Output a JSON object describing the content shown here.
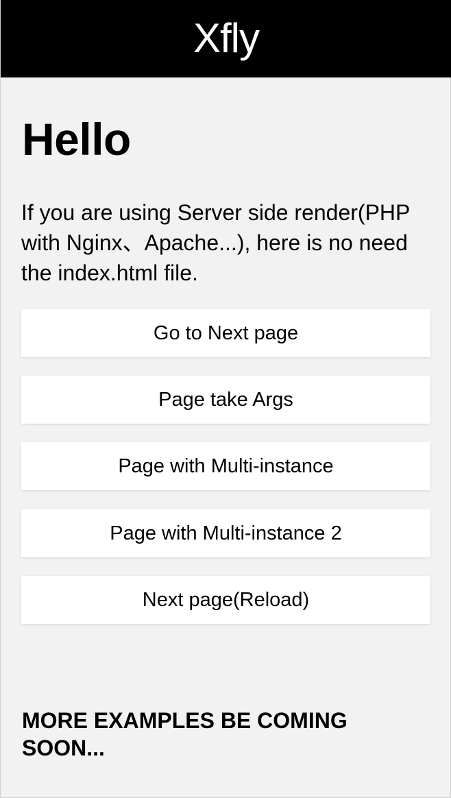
{
  "header": {
    "title": "Xfly"
  },
  "main": {
    "heading": "Hello",
    "intro": "If you are using Server side render(PHP with Nginx、Apache...), here is no need the index.html file.",
    "buttons": [
      {
        "label": "Go to Next page"
      },
      {
        "label": "Page take Args"
      },
      {
        "label": "Page with Multi-instance"
      },
      {
        "label": "Page with Multi-instance 2"
      },
      {
        "label": "Next page(Reload)"
      }
    ],
    "footer_note": "MORE EXAMPLES BE COMING SOON..."
  },
  "colors": {
    "header_bg": "#000000",
    "header_text": "#ffffff",
    "page_bg": "#f2f2f2",
    "button_bg": "#ffffff"
  }
}
